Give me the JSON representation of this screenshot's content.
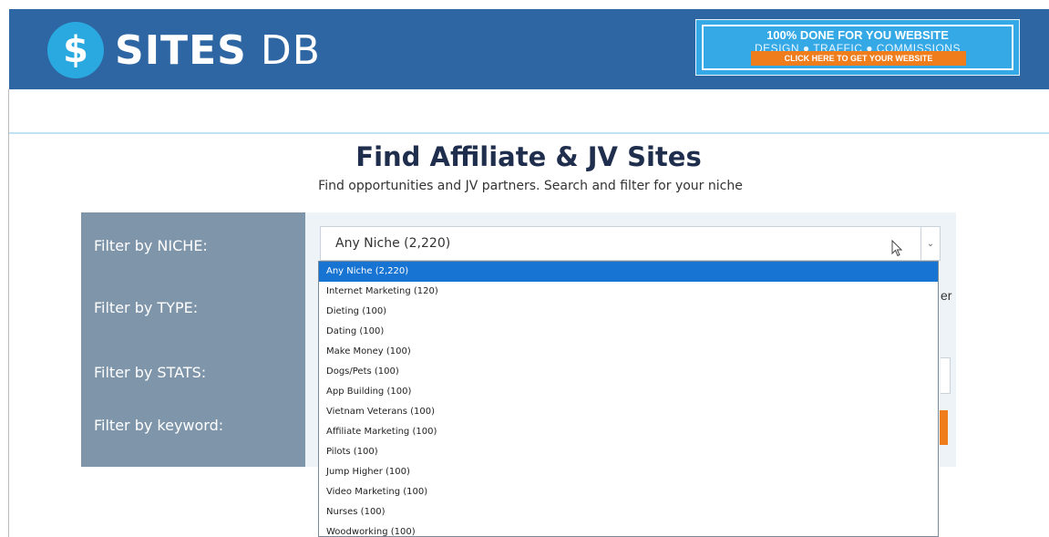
{
  "logo": {
    "symbol": "$",
    "name_bold": "SITES",
    "name_light": "DB"
  },
  "banner": {
    "line1": "100% DONE FOR YOU WEBSITE",
    "line2": "DESIGN ● TRAFFIC ● COMMISSIONS",
    "cta": "CLICK HERE TO GET YOUR WEBSITE"
  },
  "page": {
    "title": "Find Affiliate & JV Sites",
    "subtitle": "Find opportunities and JV partners. Search and filter for your niche"
  },
  "filters": {
    "niche_label": "Filter by NICHE:",
    "type_label": "Filter by TYPE:",
    "stats_label": "Filter by STATS:",
    "keyword_label": "Filter by keyword:",
    "niche_selected": "Any Niche (2,220)",
    "partial_text": "er"
  },
  "niche_options": [
    "Any Niche (2,220)",
    "Internet Marketing (120)",
    "Dieting (100)",
    "Dating (100)",
    "Make Money (100)",
    "Dogs/Pets (100)",
    "App Building (100)",
    "Vietnam Veterans (100)",
    "Affiliate Marketing (100)",
    "Pilots (100)",
    "Jump Higher (100)",
    "Video Marketing (100)",
    "Nurses (100)",
    "Woodworking (100)"
  ],
  "colors": {
    "header": "#2e66a3",
    "accent": "#2aa8e0",
    "cta": "#f07d1c",
    "label_panel": "#7f95aa",
    "selected_option": "#1874d2"
  }
}
